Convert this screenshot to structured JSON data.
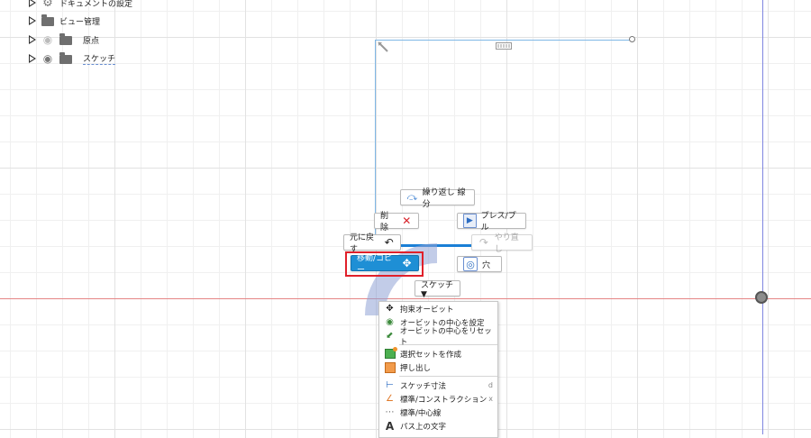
{
  "browser": {
    "items": [
      {
        "label": "ドキュメントの設定",
        "icon": "gear-icon"
      },
      {
        "label": "ビュー管理",
        "icon": "folder-icon"
      },
      {
        "label": "原点",
        "icon": "folder-icon",
        "visibility": "hidden"
      },
      {
        "label": "スケッチ",
        "icon": "folder-icon",
        "visibility": "visible"
      }
    ]
  },
  "marking_menu": {
    "repeat_label": "繰り返し 線分",
    "delete_label": "削除",
    "presspull_label": "プレス/プル",
    "undo_label": "元に戻す",
    "redo_label": "やり直し",
    "move_copy_label": "移動/コピー",
    "hole_label": "穴",
    "sketch_dropdown_label": "スケッチ ▼"
  },
  "context_menu": {
    "group1": [
      {
        "label": "拘束オービット",
        "icon": "constrained-orbit-icon"
      },
      {
        "label": "オービットの中心を設定",
        "icon": "set-orbit-center-icon"
      },
      {
        "label": "オービットの中心をリセット",
        "icon": "reset-orbit-center-icon"
      }
    ],
    "group2": [
      {
        "label": "選択セットを作成",
        "icon": "selection-set-icon"
      },
      {
        "label": "押し出し",
        "icon": "extrude-icon"
      }
    ],
    "group3": [
      {
        "label": "スケッチ寸法",
        "icon": "sketch-dimension-icon",
        "shortcut": "d"
      },
      {
        "label": "標準/コンストラクション",
        "icon": "construction-icon",
        "shortcut": "x"
      },
      {
        "label": "標準/中心線",
        "icon": "centerline-icon"
      },
      {
        "label": "パス上の文字",
        "icon": "text-on-path-icon"
      }
    ]
  },
  "colors": {
    "sketch_line": "#7fb7e6",
    "selected_line": "#1a7fd6",
    "x_axis": "#e58585",
    "y_axis": "#7f86e0",
    "highlight": "#e0202a",
    "active_button": "#1e8fd5"
  }
}
